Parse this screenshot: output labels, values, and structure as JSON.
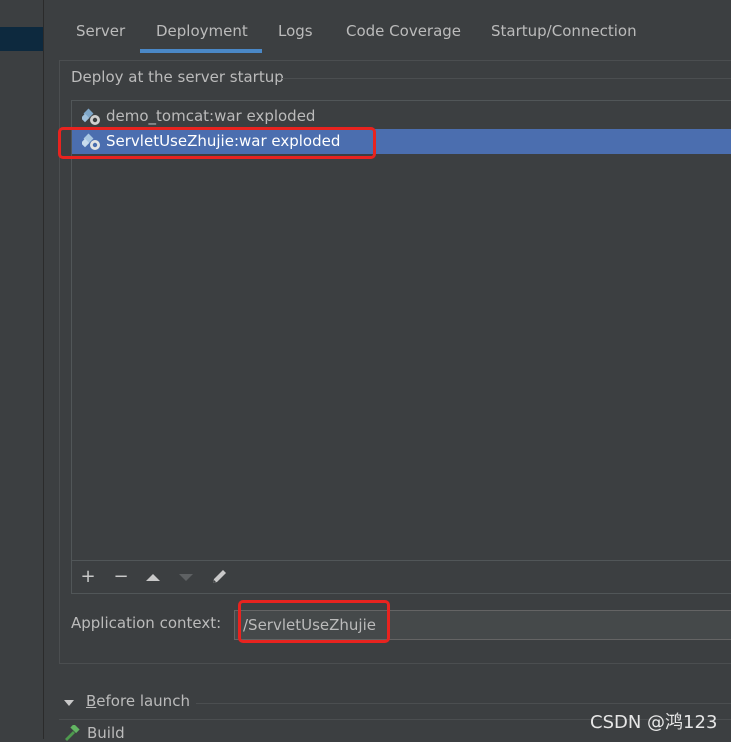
{
  "tabs": [
    {
      "label": "Server",
      "active": false
    },
    {
      "label": "Deployment",
      "active": true
    },
    {
      "label": "Logs",
      "active": false
    },
    {
      "label": "Code Coverage",
      "active": false
    },
    {
      "label": "Startup/Connection",
      "active": false
    }
  ],
  "deploy": {
    "section_title": "Deploy at the server startup",
    "items": [
      {
        "label": "demo_tomcat:war exploded",
        "icon": "artifact-icon",
        "selected": false
      },
      {
        "label": "ServletUseZhujie:war exploded",
        "icon": "artifact-icon",
        "selected": true
      }
    ],
    "toolbar": {
      "add": "+",
      "remove": "−",
      "up_icon": "arrow-up-icon",
      "down_icon": "arrow-down-icon",
      "edit_icon": "pencil-icon"
    }
  },
  "context": {
    "label": "Application context:",
    "value": "/ServletUseZhujie"
  },
  "before_launch": {
    "label_first": "B",
    "label_rest": "efore launch",
    "build_label": "Build"
  },
  "watermark": "CSDN @鸿123",
  "colors": {
    "accent": "#4a88c7",
    "selection": "#4b6eaf",
    "highlight_box": "#e8231f",
    "background": "#3c3f41"
  }
}
